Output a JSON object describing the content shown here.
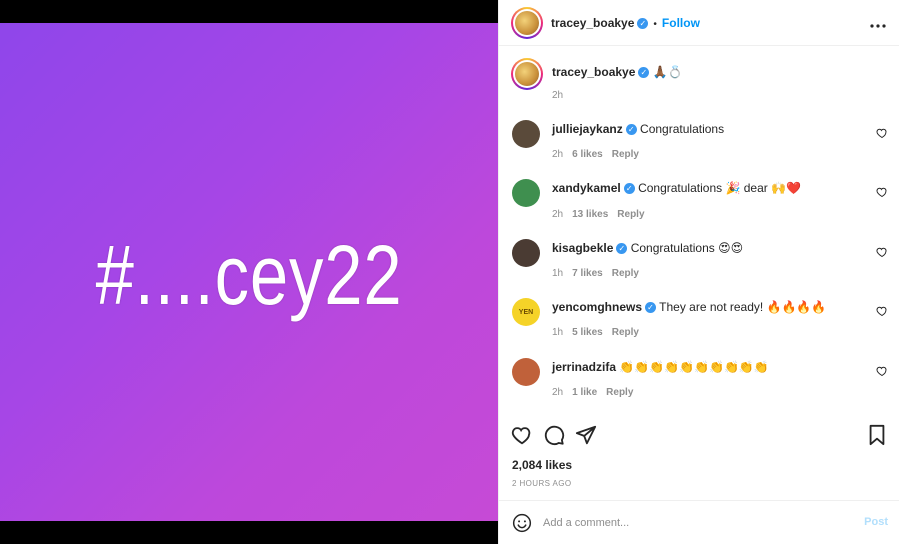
{
  "media": {
    "text": "#....cey22"
  },
  "header": {
    "username": "tracey_boakye",
    "separator": "•",
    "follow_label": "Follow",
    "more_label": "•••"
  },
  "caption": {
    "username": "tracey_boakye",
    "text": "🙏🏾💍",
    "time": "2h"
  },
  "comments": [
    {
      "username": "julliejaykanz",
      "text": "Congratulations",
      "time": "2h",
      "likes": "6 likes",
      "reply": "Reply",
      "avatar_color": "#5a4a3a"
    },
    {
      "username": "xandykamel",
      "text": "Congratulations 🎉 dear 🙌❤️",
      "time": "2h",
      "likes": "13 likes",
      "reply": "Reply",
      "avatar_color": "#3f8f4f"
    },
    {
      "username": "kisagbekle",
      "text": "Congratulations 😍😍",
      "time": "1h",
      "likes": "7 likes",
      "reply": "Reply",
      "avatar_color": "#4a3b33"
    },
    {
      "username": "yencomghnews",
      "text": "They are not ready! 🔥🔥🔥🔥",
      "time": "1h",
      "likes": "5 likes",
      "reply": "Reply",
      "avatar_color": "#f5d328",
      "avatar_text": "YEN"
    },
    {
      "username": "jerrinadzifa",
      "text": "👏👏👏👏👏👏👏👏👏👏",
      "time": "2h",
      "likes": "1 like",
      "reply": "Reply",
      "avatar_color": "#c0613a"
    }
  ],
  "stats": {
    "likes": "2,084 likes",
    "time_ago": "2 HOURS AGO"
  },
  "add_comment": {
    "placeholder": "Add a comment...",
    "post_label": "Post"
  },
  "icons": {
    "like": "heart-icon",
    "comment": "comment-icon",
    "share": "share-icon",
    "save": "bookmark-icon",
    "emoji": "emoji-icon",
    "more": "more-icon"
  },
  "colors": {
    "accent": "#0095f6",
    "verified": "#3897f0",
    "gradient_start": "#8f46ea",
    "gradient_end": "#c64ad6"
  }
}
